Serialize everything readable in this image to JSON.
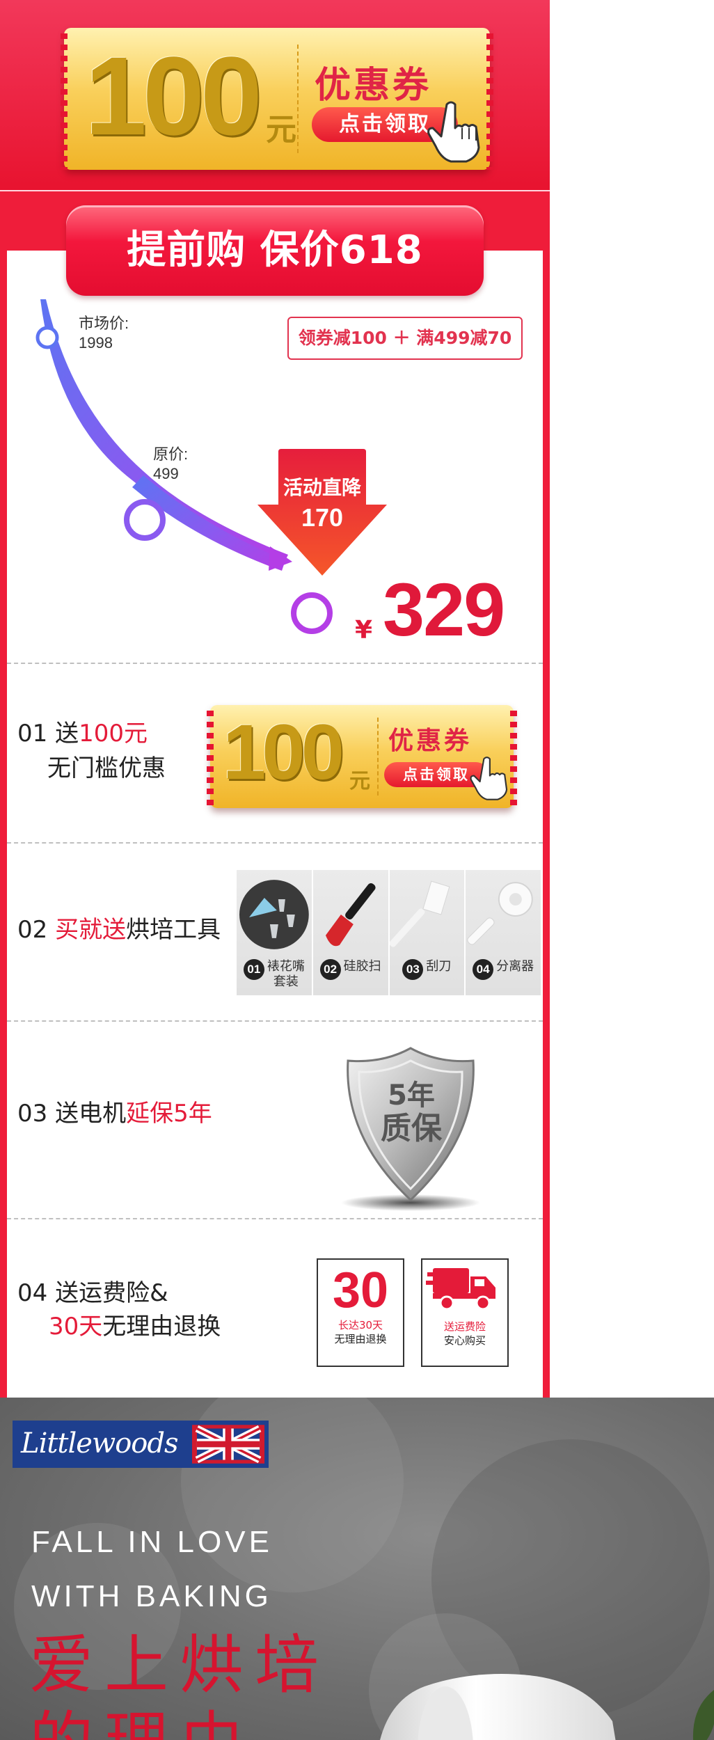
{
  "banner": {
    "coupon": {
      "amount": "100",
      "unit": "元",
      "title": "优惠券",
      "action": "点击领取"
    }
  },
  "section_title": "提前购 保价618",
  "price_curve": {
    "market_label": "市场价:",
    "market_price": "1998",
    "original_label": "原价:",
    "original_price": "499",
    "offer": "领券减100 ＋ 满499减70",
    "drop_label": "活动直降",
    "drop_amount": "170",
    "currency": "¥",
    "final_price": "329"
  },
  "benefits": [
    {
      "num": "01",
      "prefix": "送",
      "highlight": "100元",
      "line2": "无门槛优惠",
      "coupon": {
        "amount": "100",
        "unit": "元",
        "title": "优惠券",
        "action": "点击领取"
      }
    },
    {
      "num": "02",
      "highlight": "买就送",
      "suffix": "烘培工具",
      "tools": [
        {
          "num": "01",
          "name": "裱花嘴\n套装",
          "icon": "piping-tips-icon"
        },
        {
          "num": "02",
          "name": "硅胶扫",
          "icon": "silicone-brush-icon"
        },
        {
          "num": "03",
          "name": "刮刀",
          "icon": "spatula-icon"
        },
        {
          "num": "04",
          "name": "分离器",
          "icon": "egg-separator-icon"
        }
      ]
    },
    {
      "num": "03",
      "prefix": "送电机",
      "highlight": "延保5年",
      "shield": {
        "line1": "5年",
        "line2": "质保"
      }
    },
    {
      "num": "04",
      "prefix": "送运费险&",
      "highlight": "30天",
      "suffix": "无理由退换",
      "badge_return": {
        "big": "30",
        "line1": "长达30天",
        "line2": "无理由退换"
      },
      "badge_shipping": {
        "line1": "送运费险",
        "line2": "安心购买"
      }
    }
  ],
  "hero": {
    "brand": "Littlewoods",
    "en_line1": "FALL  IN  LOVE",
    "en_line2": "WITH  BAKING",
    "cn_line1": "爱上烘培",
    "cn_line2": "的理由"
  },
  "colors": {
    "brand_red": "#e41b39",
    "gold": "#f6c443",
    "brand_blue": "#1e3f8e"
  }
}
